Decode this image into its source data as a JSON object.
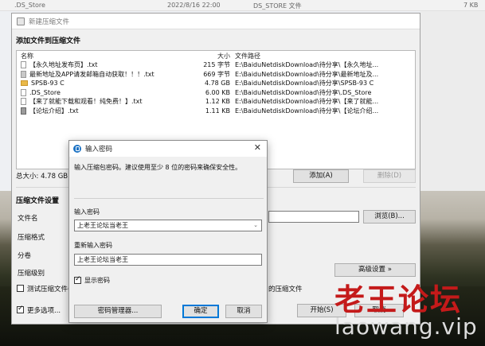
{
  "background": {
    "file_name": ".DS_Store",
    "file_date": "2022/8/16 22:00",
    "file_type": "DS_STORE 文件",
    "file_size": "7 KB"
  },
  "main": {
    "title": "新建压缩文件",
    "add_section_label": "添加文件到压缩文件",
    "columns": {
      "name": "名称",
      "size": "大小",
      "path": "文件路径"
    },
    "files": [
      {
        "name": "【永久地址发布页】.txt",
        "size": "215 字节",
        "path": "E:\\BaiduNetdiskDownload\\待分享\\【永久地址...",
        "icon": "text-file"
      },
      {
        "name": "最新地址及APP请发邮箱自动获取！！！.txt",
        "size": "669 字节",
        "path": "E:\\BaiduNetdiskDownload\\待分享\\最新地址及...",
        "icon": "image-file"
      },
      {
        "name": "SPSB-93 C",
        "size": "4.78 GB",
        "path": "E:\\BaiduNetdiskDownload\\待分享\\SPSB-93 C",
        "icon": "folder"
      },
      {
        "name": ".DS_Store",
        "size": "6.00 KB",
        "path": "E:\\BaiduNetdiskDownload\\待分享\\.DS_Store",
        "icon": "text-file"
      },
      {
        "name": "【来了就能下载和观看！纯免费！】.txt",
        "size": "1.12 KB",
        "path": "E:\\BaiduNetdiskDownload\\待分享\\【来了就能...",
        "icon": "text-file"
      },
      {
        "name": "【论坛介绍】.txt",
        "size": "1.11 KB",
        "path": "E:\\BaiduNetdiskDownload\\待分享\\【论坛介绍...",
        "icon": "stack-file"
      }
    ],
    "total_size": "总大小: 4.78 GB",
    "add_button": "添加(A)",
    "delete_button": "删除(D)",
    "settings_section_label": "压缩文件设置",
    "filename_label": "文件名",
    "browse_button": "浏览(B)...",
    "format_label": "压缩格式",
    "split_label": "分卷",
    "level_label": "压缩级别",
    "advanced_button": "高级设置 »",
    "test_checkbox_label": "测试压缩文件(",
    "delete_checkbox_tail": "的压缩文件",
    "more_options_label": "更多选项...",
    "start_button": "开始(S)",
    "cancel_button": "取消"
  },
  "password_dialog": {
    "title": "输入密码",
    "hint": "输入压缩包密码。建议使用至少 8 位的密码来确保安全性。",
    "enter_label": "输入密码",
    "enter_value": "上老王论坛当老王",
    "reenter_label": "重新输入密码",
    "reenter_value": "上老王论坛当老王",
    "show_password_label": "显示密码",
    "manager_button": "密码管理器...",
    "ok_button": "确定",
    "cancel_button": "取消"
  },
  "watermark": {
    "chinese": "老王论坛",
    "url": "laowang.vip"
  }
}
